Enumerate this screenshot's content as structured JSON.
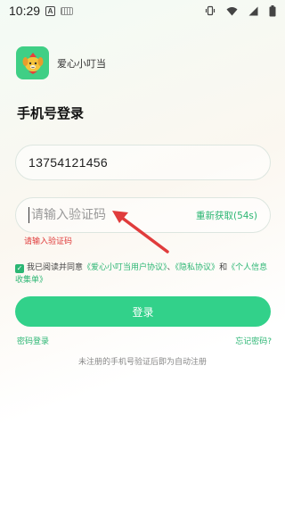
{
  "status_bar": {
    "time": "10:29",
    "icons": [
      "a-icon",
      "keyboard-icon",
      "vibrate-icon",
      "wifi-icon",
      "signal-icon",
      "battery-icon"
    ]
  },
  "app": {
    "name": "爱心小叮当",
    "accent_color": "#2bb673",
    "button_color": "#32d18a"
  },
  "page": {
    "title": "手机号登录"
  },
  "form": {
    "phone_value": "13754121456",
    "code_placeholder": "请输入验证码",
    "resend_label": "重新获取(54s)",
    "error_text": "请输入验证码"
  },
  "agreement": {
    "checked": true,
    "prefix": "我已阅读并同意",
    "user_agreement": "《爱心小叮当用户协议》",
    "sep1": "、",
    "privacy": "《隐私协议》",
    "and": "和",
    "personal_info": "《个人信息收集单》"
  },
  "actions": {
    "login_label": "登录",
    "password_login": "密码登录",
    "forgot_password": "忘记密码?"
  },
  "footer_hint": "未注册的手机号验证后即为自动注册"
}
